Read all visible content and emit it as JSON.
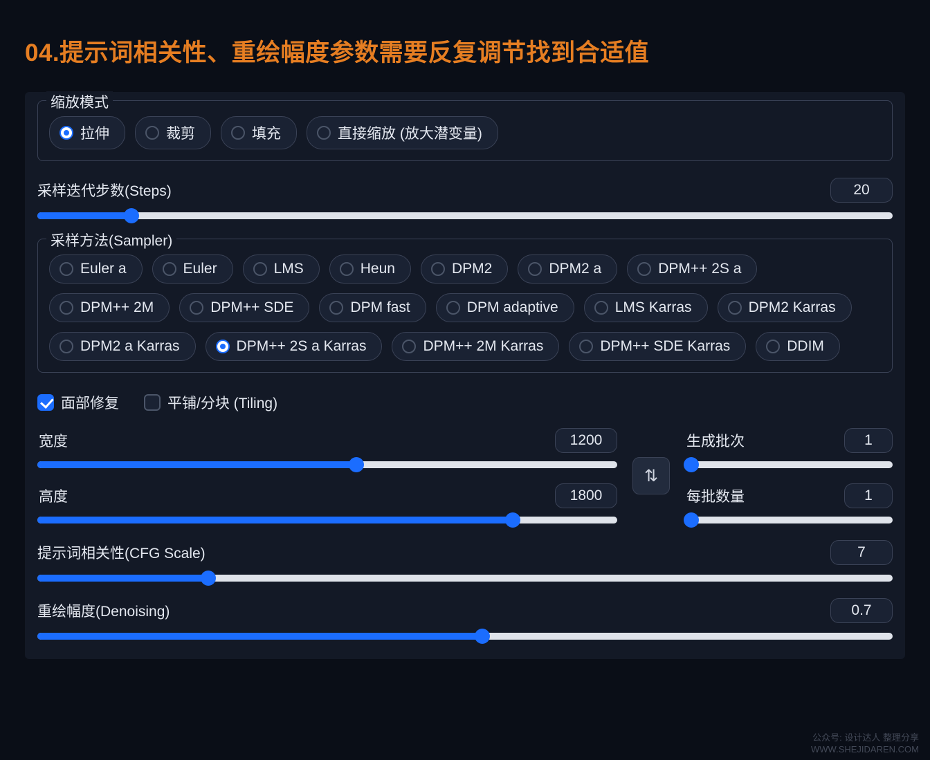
{
  "heading": "04.提示词相关性、重绘幅度参数需要反复调节找到合适值",
  "resize": {
    "legend": "缩放模式",
    "selected": 0,
    "options": [
      "拉伸",
      "裁剪",
      "填充",
      "直接缩放 (放大潜变量)"
    ]
  },
  "steps": {
    "label": "采样迭代步数(Steps)",
    "value": 20,
    "percent": 11
  },
  "sampler": {
    "legend": "采样方法(Sampler)",
    "selected": 14,
    "options": [
      "Euler a",
      "Euler",
      "LMS",
      "Heun",
      "DPM2",
      "DPM2 a",
      "DPM++ 2S a",
      "DPM++ 2M",
      "DPM++ SDE",
      "DPM fast",
      "DPM adaptive",
      "LMS Karras",
      "DPM2 Karras",
      "DPM2 a Karras",
      "DPM++ 2S a Karras",
      "DPM++ 2M Karras",
      "DPM++ SDE Karras",
      "DDIM"
    ]
  },
  "checks": {
    "face_restore": {
      "label": "面部修复",
      "checked": true
    },
    "tiling": {
      "label": "平铺/分块 (Tiling)",
      "checked": false
    }
  },
  "dims": {
    "width": {
      "label": "宽度",
      "value": 1200,
      "percent": 55
    },
    "height": {
      "label": "高度",
      "value": 1800,
      "percent": 82
    },
    "batch_count": {
      "label": "生成批次",
      "value": 1,
      "percent": 3
    },
    "batch_size": {
      "label": "每批数量",
      "value": 1,
      "percent": 3
    }
  },
  "cfg": {
    "label": "提示词相关性(CFG Scale)",
    "value": 7,
    "percent": 20
  },
  "denoise": {
    "label": "重绘幅度(Denoising)",
    "value": 0.7,
    "percent": 52
  },
  "swap_glyph": "⇅",
  "watermark": {
    "line1": "公众号: 设计达人 整理分享",
    "line2": "WWW.SHEJIDAREN.COM"
  }
}
